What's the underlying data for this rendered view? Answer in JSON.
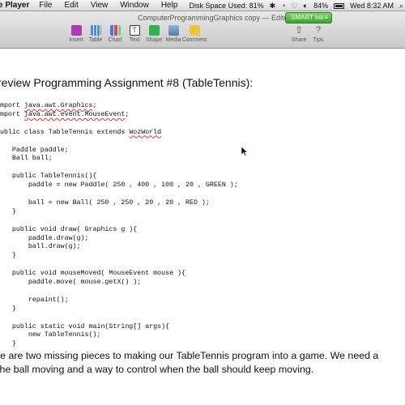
{
  "menubar": {
    "app_name": "e Player",
    "items": [
      "File",
      "Edit",
      "View",
      "Window",
      "Help"
    ],
    "disk_space": "Disk Space Used: 81%",
    "battery": "84%",
    "clock": "Wed 8:32 AM"
  },
  "toolbar": {
    "doc_title": "ComputerProgrammingGraphics copy — Edite",
    "smart_ink": "SMART Ink",
    "items": [
      {
        "label": "Insert",
        "color": "#b03ab0"
      },
      {
        "label": "Table",
        "color": "#4a90d9"
      },
      {
        "label": "Chart",
        "color": "#4a7bd9"
      },
      {
        "label": "Text",
        "color": "#333333"
      },
      {
        "label": "Shape",
        "color": "#2db34a"
      },
      {
        "label": "Media",
        "color": "#5a7a9a"
      },
      {
        "label": "Comment",
        "color": "#e8c640"
      },
      {
        "label": "Share",
        "color": "#6a6a6a"
      },
      {
        "label": "Tips",
        "color": "#6a6a6a"
      }
    ]
  },
  "document": {
    "heading": "review Programming Assignment #8 (TableTennis):",
    "code_lines": [
      "import java.awt.Graphics;",
      "import java.awt.event.MouseEvent;",
      "",
      "public class TableTennis extends WozWorld",
      "",
      "    Paddle paddle;",
      "    Ball ball;",
      "",
      "    public TableTennis(){",
      "        paddle = new Paddle( 250 , 400 , 100 , 20 , GREEN );",
      "",
      "        ball = new Ball( 250 , 250 , 20 , 20 , RED );",
      "    }",
      "",
      "    public void draw( Graphics g ){",
      "        paddle.draw(g);",
      "        ball.draw(g);",
      "    }",
      "",
      "    public void mouseMoved( MouseEvent mouse ){",
      "        paddle.move( mouse.getX() );",
      "",
      "        repaint();",
      "    }",
      "",
      "    public static void main(String[] args){",
      "        new TableTennis();",
      "    }"
    ],
    "paragraph": [
      "re are two missing pieces to making our TableTennis program into a game.  We need a",
      "the ball moving and a way to control when the ball should keep moving."
    ]
  }
}
